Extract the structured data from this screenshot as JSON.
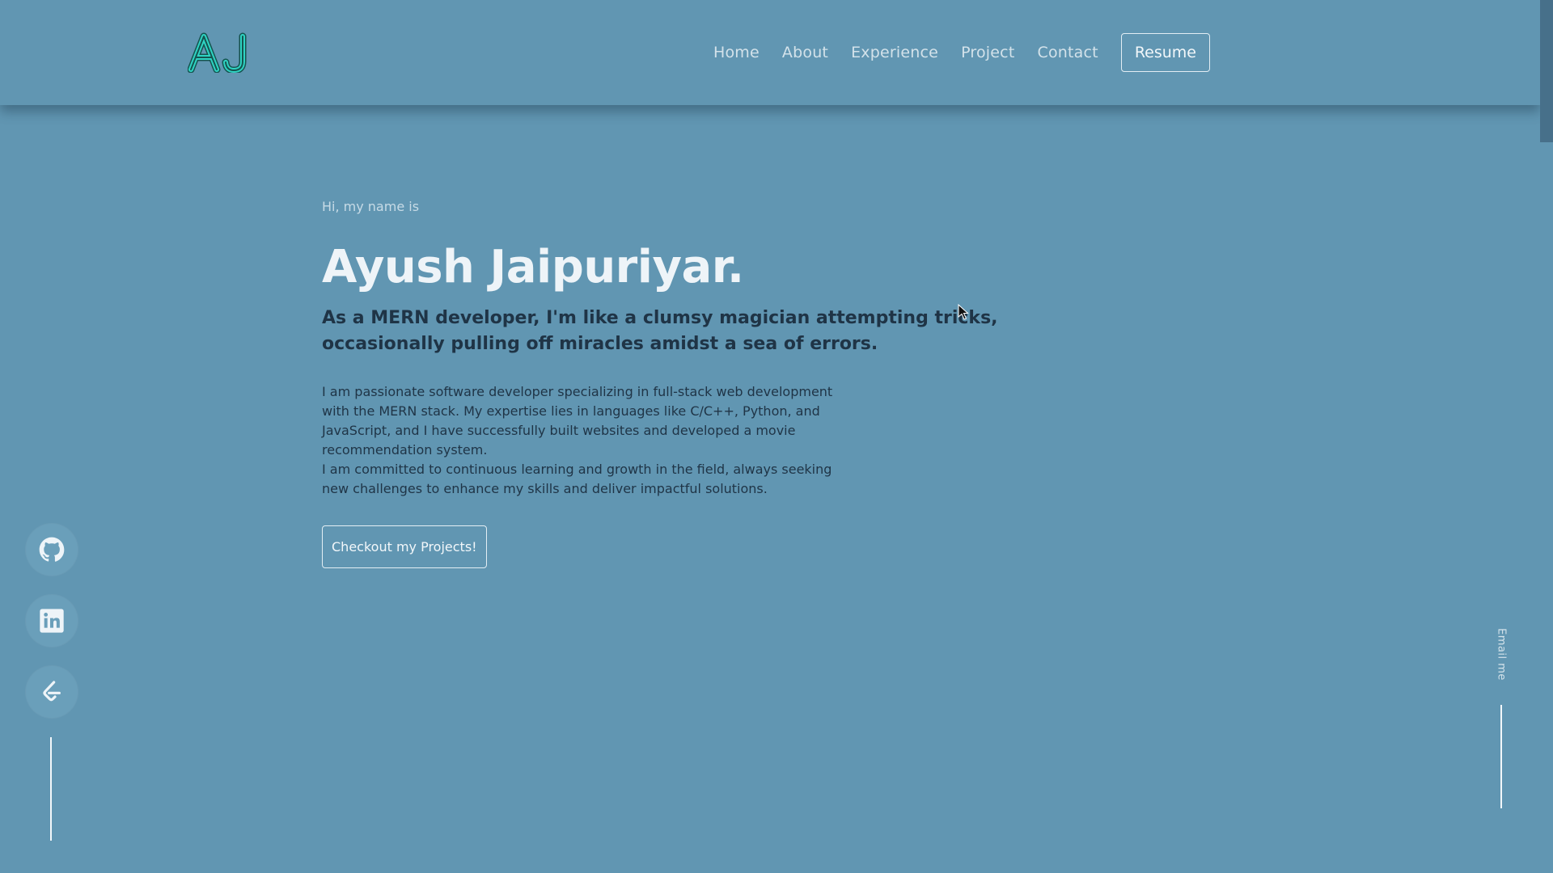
{
  "header": {
    "logo_text": "AJ",
    "nav": [
      "Home",
      "About",
      "Experience",
      "Project",
      "Contact"
    ],
    "resume_label": "Resume"
  },
  "hero": {
    "greeting": "Hi, my name is",
    "name": "Ayush Jaipuriyar.",
    "tagline": "As a MERN developer, I'm like a clumsy magician attempting tricks, occasionally pulling off miracles amidst a sea of errors.",
    "about": [
      "I am passionate software developer specializing in full-stack web development with the MERN stack. My expertise lies in languages like C/C++, Python, and JavaScript, and I have successfully built websites and developed a movie recommendation system.",
      "I am committed to continuous learning and growth in the field, always seeking new challenges to enhance my skills and deliver impactful solutions."
    ],
    "cta_label": "Checkout my Projects!"
  },
  "social": [
    "github-icon",
    "linkedin-icon",
    "leetcode-icon"
  ],
  "email_label": "Email me",
  "colors": {
    "background": "#6196b2",
    "name_text": "#eef4f8",
    "body_text": "#1f3446",
    "logo_accent": "#2fd3c3"
  }
}
